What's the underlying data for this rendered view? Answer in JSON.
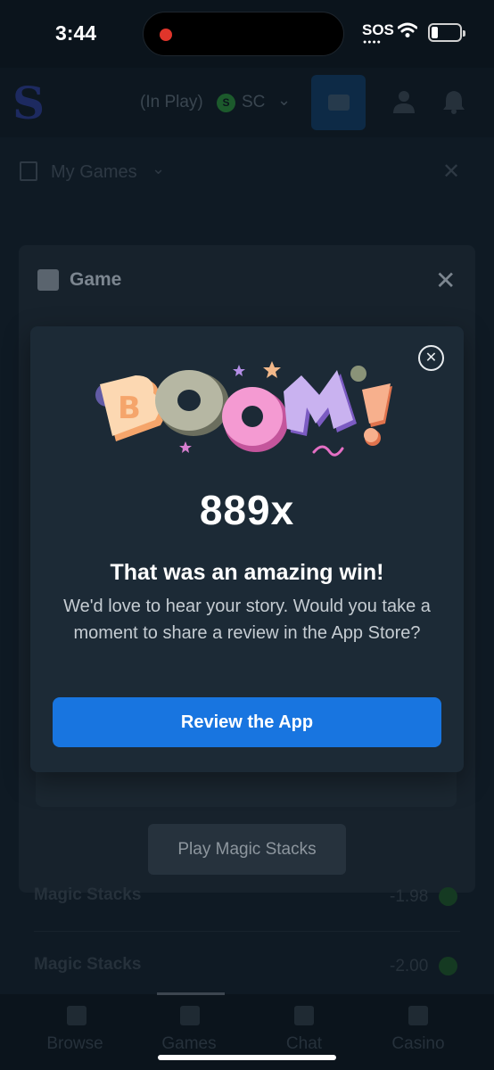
{
  "status_bar": {
    "time": "3:44",
    "carrier": "SOS"
  },
  "header": {
    "in_play_label": "(In Play)",
    "currency_icon": "S",
    "currency_label": "SC"
  },
  "my_games": {
    "label": "My Games"
  },
  "game_panel": {
    "title": "Game",
    "play_button_label": "Play Magic Stacks"
  },
  "history": [
    {
      "game": "Magic Stacks",
      "amount": "-1.98"
    },
    {
      "game": "Magic Stacks",
      "amount": "-2.00"
    }
  ],
  "tabs": [
    {
      "label": "Browse",
      "icon": "browse-icon"
    },
    {
      "label": "Games",
      "icon": "games-icon"
    },
    {
      "label": "Chat",
      "icon": "chat-icon"
    },
    {
      "label": "Casino",
      "icon": "casino-icon"
    }
  ],
  "modal": {
    "multiplier": "889x",
    "headline": "That was an amazing win!",
    "body": "We'd love to hear your story. Would you take a moment to share a review in the App Store?",
    "review_button_label": "Review the App",
    "colors": {
      "button": "#1875e0",
      "background": "#1c2a36"
    }
  }
}
